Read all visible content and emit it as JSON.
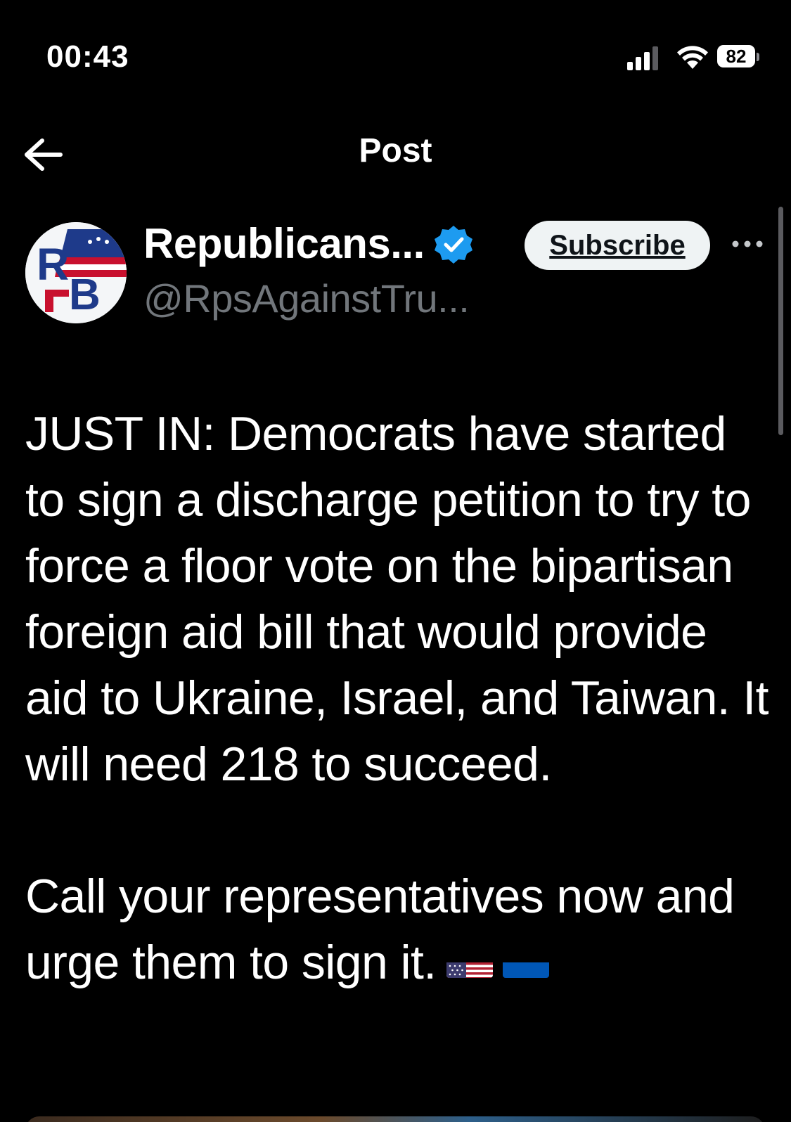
{
  "status_bar": {
    "time": "00:43",
    "battery_level": "82",
    "icons": [
      "signal-icon",
      "wifi-icon",
      "battery-icon"
    ]
  },
  "nav": {
    "title": "Post",
    "back_icon": "arrow-left-icon"
  },
  "post": {
    "author": {
      "display_name": "Republicans...",
      "handle": "@RpsAgainstTru...",
      "verified": true,
      "avatar_text": "RB"
    },
    "subscribe_label": "Subscribe",
    "more_icon": "more-horizontal-icon",
    "text_paragraph_1": "JUST IN: Democrats have started to sign a discharge petition to try to force a floor vote on the bipartisan foreign aid bill that would provide aid to Ukraine, Israel, and Taiwan. It will need 218 to succeed.",
    "text_paragraph_2": "Call your representatives now and urge them to sign it.",
    "emojis": [
      "us-flag-icon",
      "ukraine-flag-icon"
    ]
  },
  "colors": {
    "background": "#000000",
    "text_primary": "#ffffff",
    "text_secondary": "#71767b",
    "verified_blue": "#1d9bf0",
    "subscribe_bg": "#eff3f4"
  }
}
